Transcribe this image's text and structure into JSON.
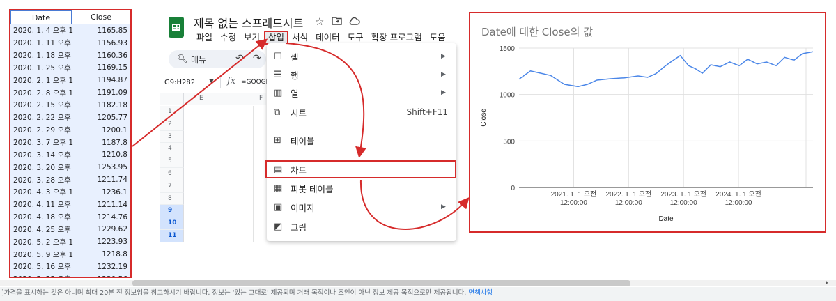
{
  "table": {
    "headers": {
      "date": "Date",
      "close": "Close"
    },
    "rows": [
      {
        "date": "2020. 1. 4 오후 1",
        "close": "1165.85"
      },
      {
        "date": "2020. 1. 11 오후",
        "close": "1156.93"
      },
      {
        "date": "2020. 1. 18 오후",
        "close": "1160.36"
      },
      {
        "date": "2020. 1. 25 오후",
        "close": "1169.15"
      },
      {
        "date": "2020. 2. 1 오후 1",
        "close": "1194.87"
      },
      {
        "date": "2020. 2. 8 오후 1",
        "close": "1191.09"
      },
      {
        "date": "2020. 2. 15 오후",
        "close": "1182.18"
      },
      {
        "date": "2020. 2. 22 오후",
        "close": "1205.77"
      },
      {
        "date": "2020. 2. 29 오후",
        "close": "1200.1"
      },
      {
        "date": "2020. 3. 7 오후 1",
        "close": "1187.8"
      },
      {
        "date": "2020. 3. 14 오후",
        "close": "1210.8"
      },
      {
        "date": "2020. 3. 20 오후",
        "close": "1253.95"
      },
      {
        "date": "2020. 3. 28 오후",
        "close": "1211.74"
      },
      {
        "date": "2020. 4. 3 오후 1",
        "close": "1236.1"
      },
      {
        "date": "2020. 4. 11 오후",
        "close": "1211.14"
      },
      {
        "date": "2020. 4. 18 오후",
        "close": "1214.76"
      },
      {
        "date": "2020. 4. 25 오후",
        "close": "1229.62"
      },
      {
        "date": "2020. 5. 2 오후 1",
        "close": "1223.93"
      },
      {
        "date": "2020. 5. 9 오후 1",
        "close": "1218.8"
      },
      {
        "date": "2020. 5. 16 오후",
        "close": "1232.19"
      },
      {
        "date": "2020. 5. 23 오후",
        "close": "1230.56"
      }
    ]
  },
  "sheets": {
    "doc_title": "제목 없는 스프레드시트",
    "title_icons": [
      "star-icon",
      "folder-move-icon",
      "cloud-icon"
    ],
    "menu": [
      "파일",
      "수정",
      "보기",
      "삽입",
      "서식",
      "데이터",
      "도구",
      "확장 프로그램",
      "도움"
    ],
    "active_menu": "삽입",
    "toolbar": {
      "search_label": "메뉴"
    },
    "name_box": "G9:H282",
    "fx_label": "fx",
    "formula": "=GOOGL",
    "columns": [
      "E",
      "F"
    ],
    "rows": [
      "1",
      "2",
      "3",
      "4",
      "5",
      "6",
      "7",
      "8",
      "9",
      "10",
      "11"
    ],
    "selected_rows": [
      "9",
      "10",
      "11"
    ]
  },
  "insert_menu": {
    "items": [
      {
        "label": "셀",
        "icon": "cell-icon",
        "submenu": true
      },
      {
        "label": "행",
        "icon": "row-icon",
        "submenu": true
      },
      {
        "label": "열",
        "icon": "column-icon",
        "submenu": true
      },
      {
        "label": "시트",
        "icon": "sheet-icon",
        "shortcut": "Shift+F11"
      },
      {
        "label": "테이블",
        "icon": "table-icon"
      },
      {
        "label": "차트",
        "icon": "chart-icon",
        "highlighted": true
      },
      {
        "label": "피봇 테이블",
        "icon": "pivot-table-icon"
      },
      {
        "label": "이미지",
        "icon": "image-icon",
        "submenu": true
      },
      {
        "label": "그림",
        "icon": "drawing-icon"
      }
    ]
  },
  "chart_data": {
    "type": "line",
    "title": "Date에 대한 Close의 값",
    "xlabel": "Date",
    "ylabel": "Close",
    "ylim": [
      0,
      1500
    ],
    "yticks": [
      0,
      500,
      1000,
      1500
    ],
    "x_ticks": [
      {
        "line1": "2021. 1. 1 오전",
        "line2": "12:00:00",
        "date": "2021-01-01"
      },
      {
        "line1": "2022. 1. 1 오전",
        "line2": "12:00:00",
        "date": "2022-01-01"
      },
      {
        "line1": "2023. 1. 1 오전",
        "line2": "12:00:00",
        "date": "2023-01-01"
      },
      {
        "line1": "2024. 1. 1 오전",
        "line2": "12:00:00",
        "date": "2024-01-01"
      }
    ],
    "xlim": [
      "2020-01-04",
      "2025-05-10"
    ],
    "grid": true,
    "legend": "none",
    "series": [
      {
        "color": "#4a86e8",
        "x": [
          "2020-01-04",
          "2020-03-20",
          "2020-05-23",
          "2020-08-01",
          "2020-10-31",
          "2021-01-30",
          "2021-04-03",
          "2021-06-05",
          "2021-09-04",
          "2021-12-04",
          "2022-03-05",
          "2022-05-07",
          "2022-07-02",
          "2022-08-27",
          "2022-10-08",
          "2022-12-10",
          "2023-02-04",
          "2023-03-18",
          "2023-05-06",
          "2023-07-01",
          "2023-09-02",
          "2023-11-04",
          "2024-01-06",
          "2024-03-02",
          "2024-05-04",
          "2024-07-06",
          "2024-09-07",
          "2024-11-02",
          "2025-01-04",
          "2025-03-01",
          "2025-05-10"
        ],
        "values": [
          1165,
          1254,
          1231,
          1205,
          1110,
          1085,
          1110,
          1155,
          1170,
          1180,
          1200,
          1185,
          1225,
          1300,
          1350,
          1420,
          1310,
          1280,
          1230,
          1320,
          1300,
          1350,
          1310,
          1380,
          1330,
          1350,
          1310,
          1400,
          1370,
          1440,
          1460
        ]
      }
    ]
  },
  "footer": {
    "disclaimer": "]가격을 표시하는 것은 아니며 최대 20분 전 정보임을 참고하시기 바랍니다. 정보는 '있는 그대로' 제공되며 거래 목적이나 조언이 아닌 정보 제공 목적으로만 제공됩니다.",
    "disclaimer_link": "면책사항"
  },
  "colors": {
    "accent_red": "#d62b2b",
    "sheets_green": "#188038",
    "line_blue": "#4a86e8"
  }
}
